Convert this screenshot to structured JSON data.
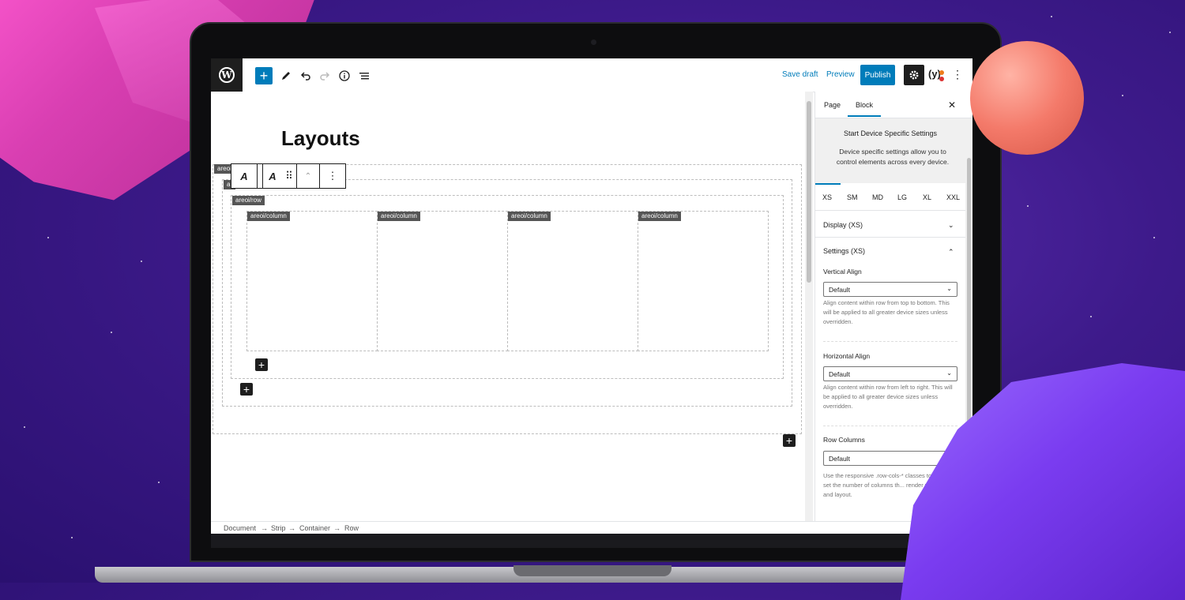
{
  "toolbar": {
    "wp_logo": "W",
    "add_icon": "+",
    "save_draft": "Save draft",
    "preview": "Preview",
    "publish": "Publish",
    "yoast": "(y)",
    "kebab": "⋮"
  },
  "editor": {
    "title": "Layouts",
    "tags": {
      "strip": "areoi",
      "container": "ar",
      "row": "areoi/row",
      "column": "areoi/column"
    },
    "plus": "+",
    "block_toolbar": {
      "icon1": "A",
      "icon2": "A",
      "drag": "⠿",
      "mover": "⌃",
      "more": "⋮"
    }
  },
  "breadcrumb": {
    "items": [
      "Document",
      "Strip",
      "Container",
      "Row"
    ],
    "separator": "→"
  },
  "sidebar": {
    "tabs": [
      "Page",
      "Block"
    ],
    "active_tab": "Block",
    "close": "✕",
    "notice_title": "Start Device Specific Settings",
    "notice_text": "Device specific settings allow you to control elements across every device.",
    "devices": [
      "XS",
      "SM",
      "MD",
      "LG",
      "XL",
      "XXL"
    ],
    "active_device": "XS",
    "display_panel": "Display (XS)",
    "settings_panel": "Settings (XS)",
    "vertical_align_label": "Vertical Align",
    "vertical_align_value": "Default",
    "vertical_align_help": "Align content within row from top to bottom. This will be applied to all greater device sizes unless overridden.",
    "horizontal_align_label": "Horizontal Align",
    "horizontal_align_value": "Default",
    "horizontal_align_help": "Align content within row from left to right. This will be applied to all greater device sizes unless overridden.",
    "row_columns_label": "Row Columns",
    "row_columns_value": "Default",
    "row_columns_help": "Use the responsive .row-cols-* classes to quickly set the number of columns th... render your content and layout."
  },
  "colors": {
    "accent": "#007cba",
    "dark": "#1e1e1e",
    "background": "#3d1a8a"
  }
}
